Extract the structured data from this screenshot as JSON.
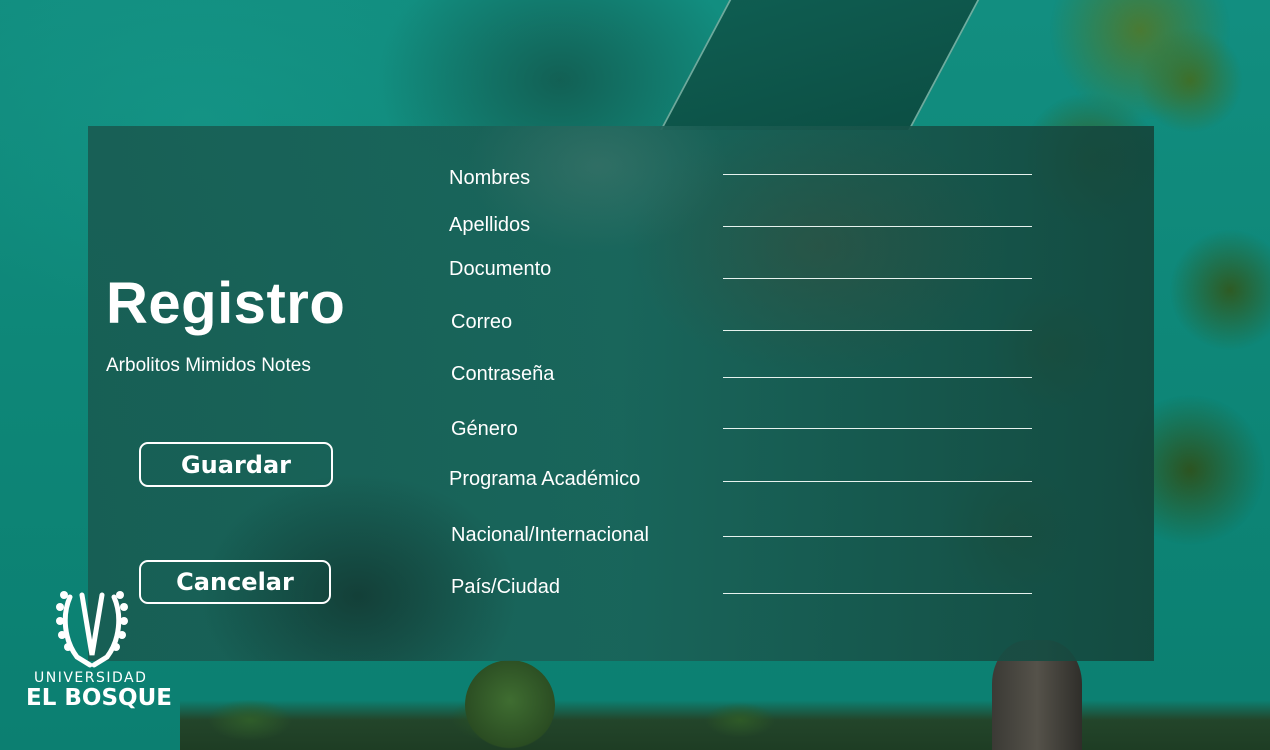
{
  "header": {
    "title": "Registro",
    "subtitle": "Arbolitos Mimidos Notes"
  },
  "buttons": {
    "save_label": "Guardar",
    "cancel_label": "Cancelar"
  },
  "form": {
    "fields": [
      {
        "label": "Nombres",
        "value": ""
      },
      {
        "label": "Apellidos",
        "value": ""
      },
      {
        "label": "Documento",
        "value": ""
      },
      {
        "label": "Correo",
        "value": ""
      },
      {
        "label": "Contraseña",
        "value": ""
      },
      {
        "label": "Género",
        "value": ""
      },
      {
        "label": "Programa Académico",
        "value": ""
      },
      {
        "label": "Nacional/Internacional",
        "value": ""
      },
      {
        "label": "País/Ciudad",
        "value": ""
      }
    ]
  },
  "logo": {
    "line1": "UNIVERSIDAD",
    "line2": "EL BOSQUE",
    "icon": "el-bosque-crest-icon"
  },
  "colors": {
    "background": "#0f8a7a",
    "panel": "#1a6258",
    "text": "#ffffff"
  }
}
